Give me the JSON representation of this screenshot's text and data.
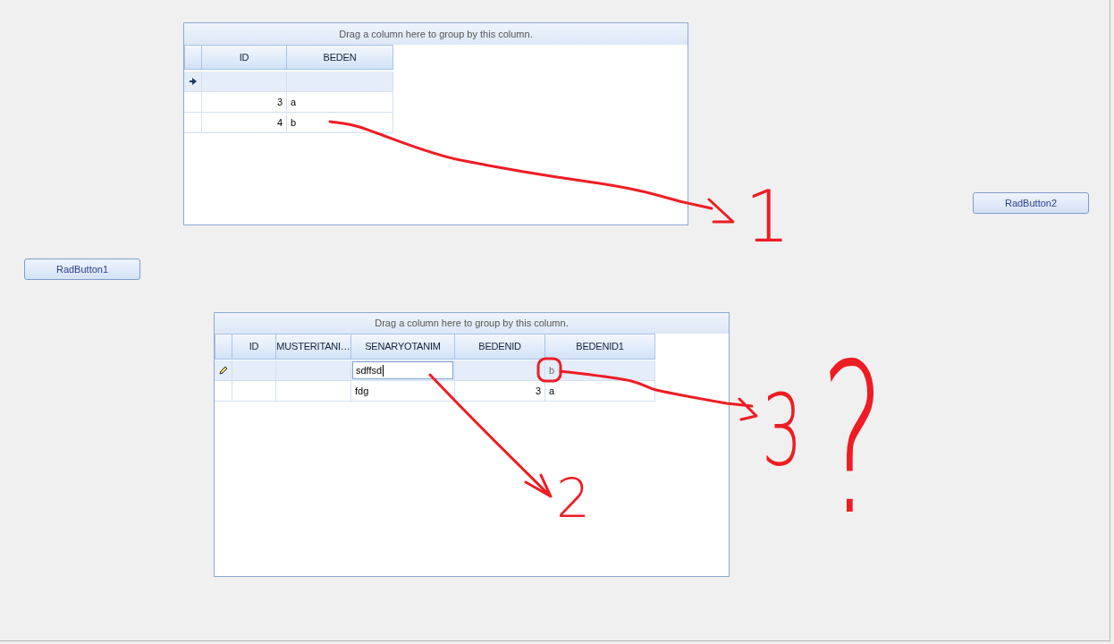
{
  "top_grid": {
    "group_panel": "Drag a column here to group by this column.",
    "columns": [
      {
        "label": "ID",
        "kind": "number"
      },
      {
        "label": "BEDEN",
        "kind": "text"
      }
    ],
    "new_row": {
      "current": true,
      "editing": false
    },
    "rows": [
      {
        "cells": [
          "3",
          "a"
        ]
      },
      {
        "cells": [
          "4",
          "b"
        ]
      }
    ]
  },
  "right_button": {
    "label": "RadButton2"
  },
  "left_button": {
    "label": "RadButton1"
  },
  "bottom_grid": {
    "group_panel": "Drag a column here to group by this column.",
    "columns": [
      {
        "label": "ID",
        "kind": "number"
      },
      {
        "label": "MUSTERITANI…",
        "kind": "text"
      },
      {
        "label": "SENARYOTANIM",
        "kind": "text"
      },
      {
        "label": "BEDENID",
        "kind": "number"
      },
      {
        "label": "BEDENID1",
        "kind": "text"
      }
    ],
    "new_row": {
      "editing": true,
      "cells": [
        null,
        null,
        {
          "kind": "editor",
          "text": "sdffsd"
        },
        null,
        {
          "kind": "default",
          "text": "b"
        }
      ]
    },
    "rows": [
      {
        "cells": [
          null,
          null,
          "fdg",
          "3",
          "a"
        ]
      }
    ]
  },
  "annotations": [
    {
      "label": "1"
    },
    {
      "label": "2"
    },
    {
      "label": "3"
    },
    {
      "label": "?"
    }
  ]
}
